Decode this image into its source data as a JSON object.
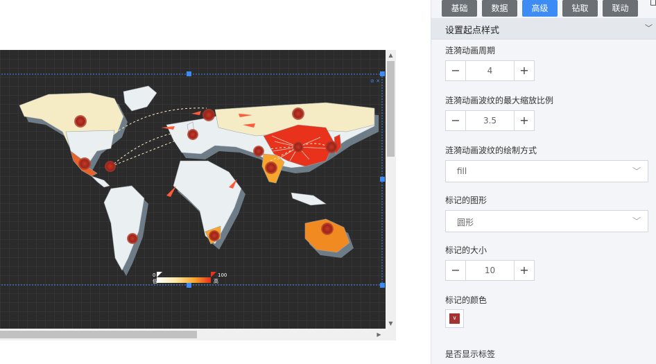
{
  "tabs": [
    {
      "label": "基础",
      "active": false
    },
    {
      "label": "数据",
      "active": false
    },
    {
      "label": "高级",
      "active": true
    },
    {
      "label": "钻取",
      "active": false
    },
    {
      "label": "联动",
      "active": false
    }
  ],
  "section": {
    "title": "设置起点样式"
  },
  "fields": {
    "ripple_period": {
      "label": "涟漪动画周期",
      "value": "4"
    },
    "ripple_scale": {
      "label": "涟漪动画波纹的最大缩放比例",
      "value": "3.5"
    },
    "ripple_brush": {
      "label": "涟漪动画波纹的绘制方式",
      "value": "fill"
    },
    "symbol_shape": {
      "label": "标记的图形",
      "value": "圆形"
    },
    "symbol_size": {
      "label": "标记的大小",
      "value": "10"
    },
    "symbol_color": {
      "label": "标记的颜色",
      "color": "#a33232"
    },
    "show_label": {
      "label": "是否显示标签"
    }
  },
  "map": {
    "legend_min": "0",
    "legend_max": "100",
    "legend_low": "低",
    "legend_high": "高",
    "gradient_colors": [
      "#ffffff",
      "#fbe8a6",
      "#f7a52c",
      "#e8321b"
    ],
    "background": "#2b2b2b"
  },
  "colors": {
    "accent": "#3d8cf5",
    "tab_inactive": "#6b7075"
  }
}
